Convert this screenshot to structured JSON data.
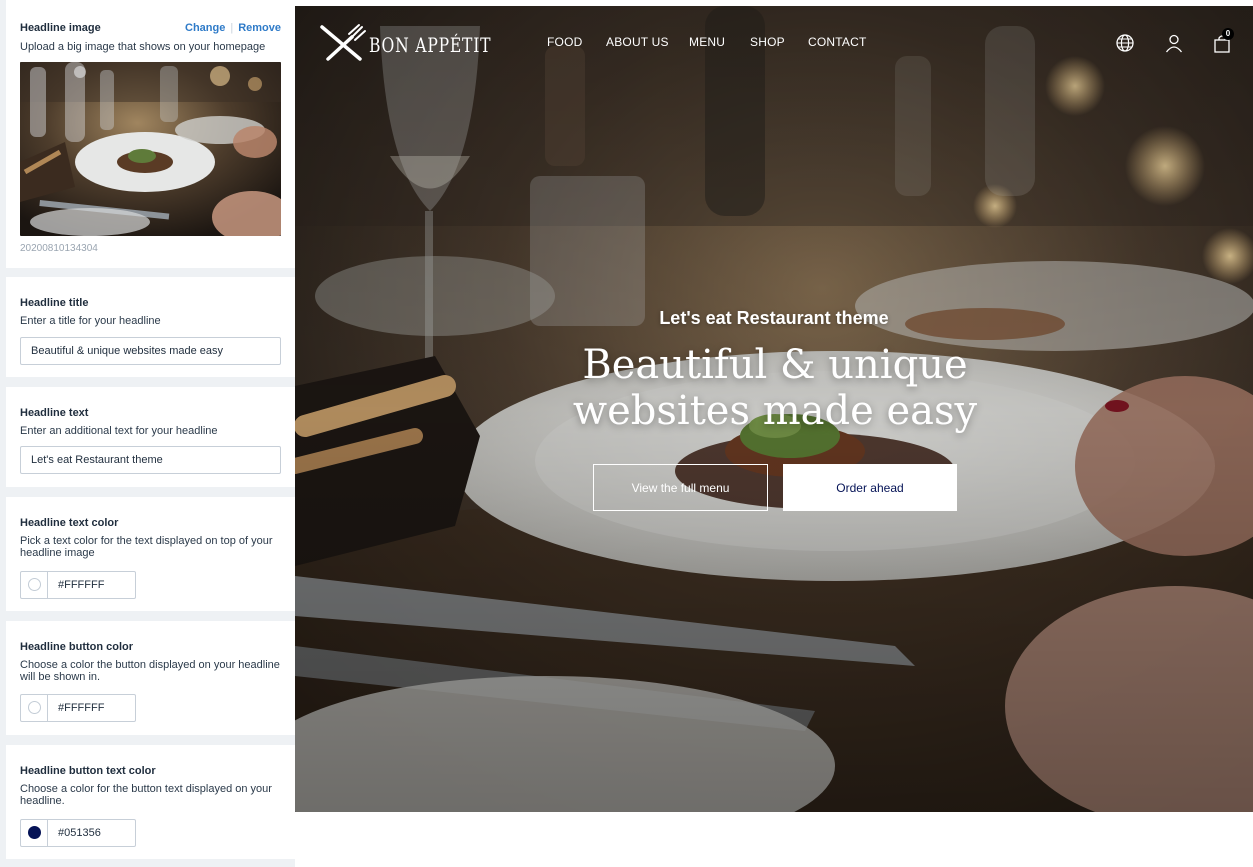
{
  "settings": {
    "image": {
      "title": "Headline image",
      "description": "Upload a big image that shows on your homepage",
      "change_label": "Change",
      "remove_label": "Remove",
      "filename": "20200810134304"
    },
    "title": {
      "title": "Headline title",
      "description": "Enter a title for your headline",
      "value": "Beautiful & unique websites made easy"
    },
    "text": {
      "title": "Headline text",
      "description": "Enter an additional text for your headline",
      "value": "Let's eat Restaurant theme"
    },
    "text_color": {
      "title": "Headline text color",
      "description": "Pick a text color for the text displayed on top of your headline image",
      "value": "#FFFFFF"
    },
    "button_color": {
      "title": "Headline button color",
      "description": "Choose a color the button displayed on your headline will be shown in.",
      "value": "#FFFFFF"
    },
    "button_text_color": {
      "title": "Headline button text color",
      "description": "Choose a color for the button text displayed on your headline.",
      "value": "#051356"
    }
  },
  "preview": {
    "brand": "BON APPÉTIT",
    "nav": [
      "FOOD",
      "ABOUT US",
      "MENU",
      "SHOP",
      "CONTACT"
    ],
    "icons": [
      "globe-icon",
      "user-icon",
      "shopping-bag-icon"
    ],
    "cart_count": "0",
    "eyebrow": "Let's eat Restaurant theme",
    "headline": "Beautiful & unique websites made easy",
    "buttons": {
      "primary": "View the full menu",
      "secondary": "Order ahead"
    }
  }
}
